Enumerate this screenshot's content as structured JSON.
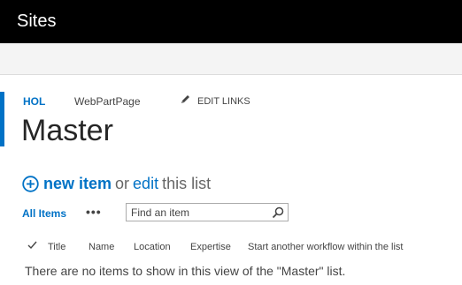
{
  "suitebar": {
    "title": "Sites"
  },
  "topnav": {
    "items": [
      {
        "label": "HOL"
      },
      {
        "label": "WebPartPage"
      }
    ],
    "edit_links_label": "EDIT LINKS"
  },
  "page": {
    "title": "Master"
  },
  "hero": {
    "new_item_label": "new item",
    "or_text": "or",
    "edit_label": "edit",
    "this_list_text": "this list"
  },
  "views": {
    "all_items_label": "All Items",
    "more_label": "•••"
  },
  "search": {
    "placeholder": "Find an item",
    "value": ""
  },
  "list": {
    "columns": [
      "Title",
      "Name",
      "Location",
      "Expertise",
      "Start another workflow within the list"
    ],
    "empty_message": "There are no items to show in this view of the \"Master\" list."
  },
  "colors": {
    "accent": "#0072c6",
    "suitebar": "#000000"
  },
  "icons": [
    "pencil-icon",
    "plus-circle-icon",
    "search-icon",
    "checkmark-icon",
    "ellipsis-icon"
  ]
}
